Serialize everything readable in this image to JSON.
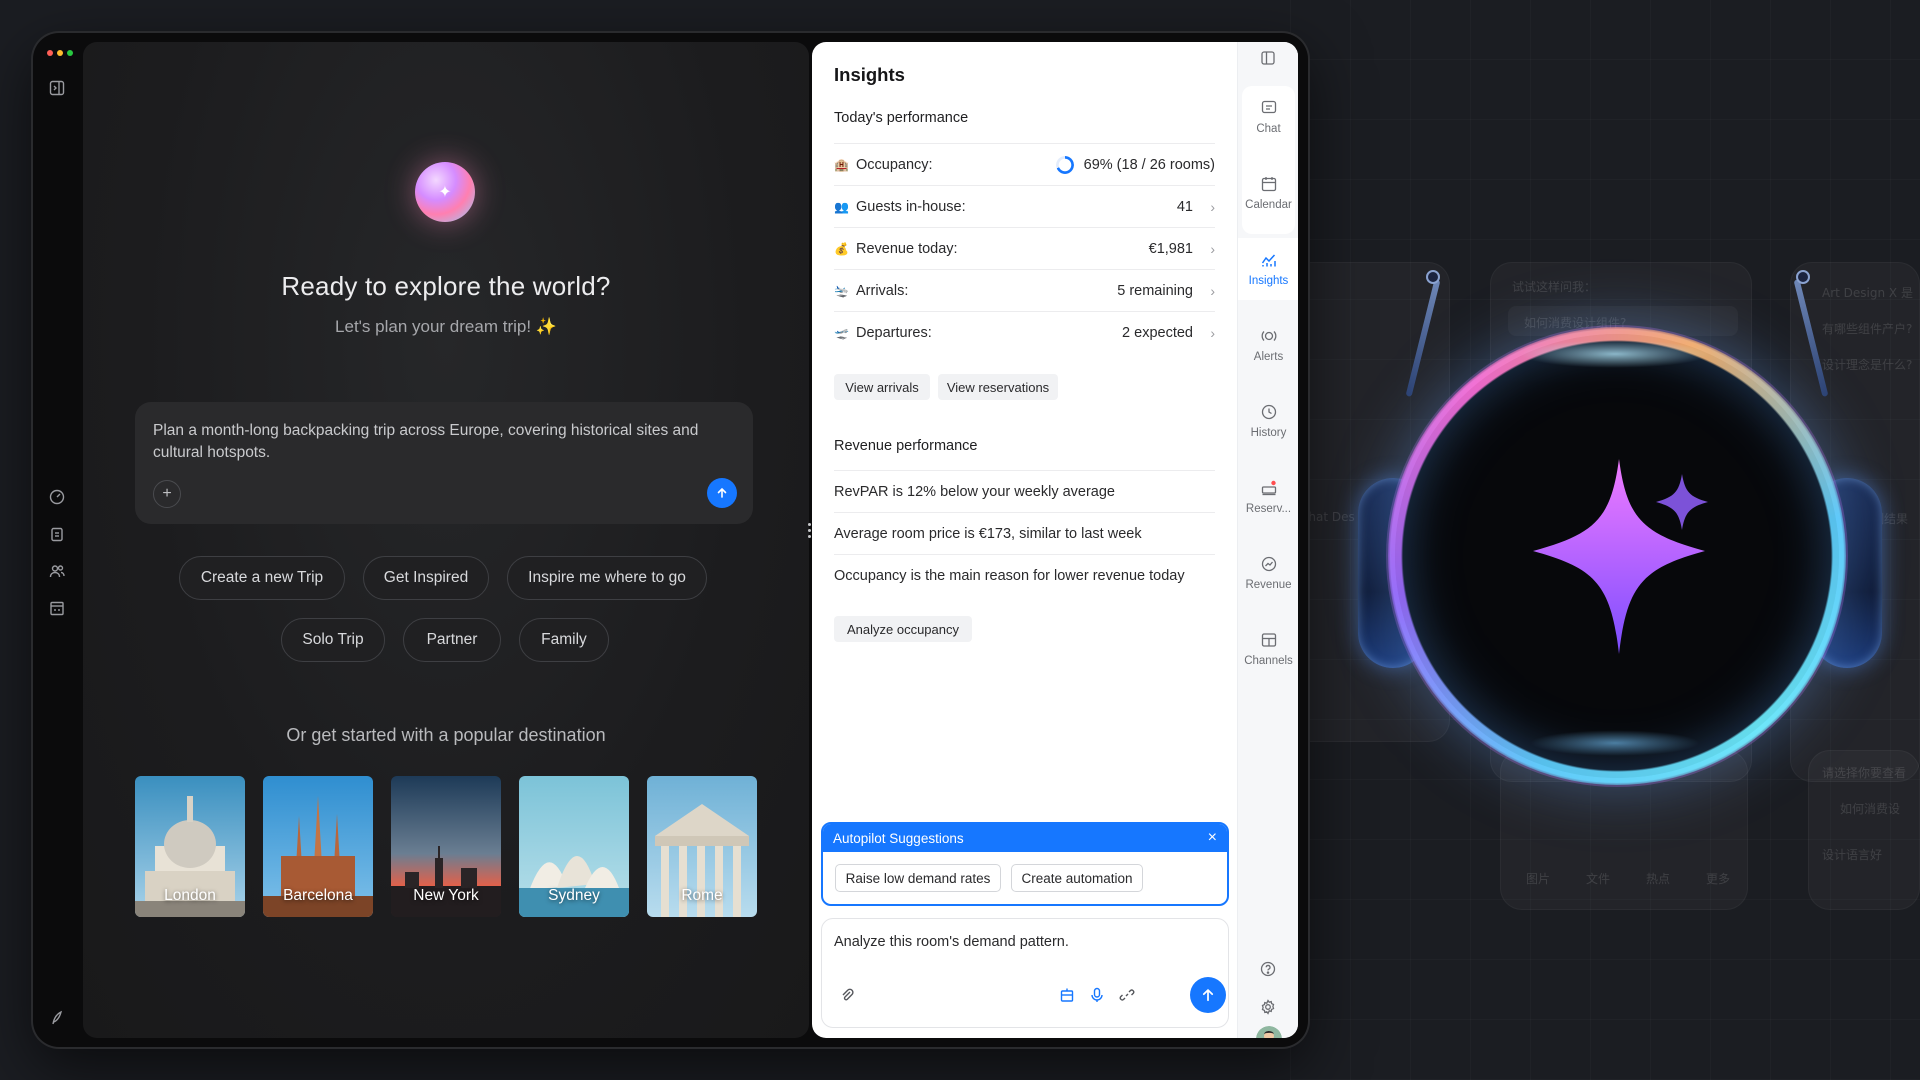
{
  "left_app": {
    "hero": {
      "title": "Ready to explore the world?",
      "subtitle": "Let's plan your dream trip! ✨",
      "orb_glyph": "✦"
    },
    "prompt": {
      "text": "Plan a month-long backpacking trip across Europe, covering historical sites and cultural hotspots.",
      "plus_label": "+"
    },
    "chips": [
      {
        "label": "Create a new Trip"
      },
      {
        "label": "Get Inspired"
      },
      {
        "label": "Inspire me where to go"
      },
      {
        "label": "Solo Trip"
      },
      {
        "label": "Partner"
      },
      {
        "label": "Family"
      }
    ],
    "destinations_title": "Or get started with a popular destination",
    "destinations": [
      {
        "name": "London"
      },
      {
        "name": "Barcelona"
      },
      {
        "name": "New York"
      },
      {
        "name": "Sydney"
      },
      {
        "name": "Rome"
      }
    ],
    "rail_icons": [
      "sidebar-toggle-icon",
      "dashboard-icon",
      "clipboard-icon",
      "users-icon",
      "building-icon",
      "feather-icon"
    ]
  },
  "insights": {
    "title": "Insights",
    "today_heading": "Today's performance",
    "metrics": [
      {
        "emoji": "🏨",
        "label": "Occupancy:",
        "value": "69% (18 / 26 rooms)",
        "fill": 0.69
      },
      {
        "emoji": "👥",
        "label": "Guests in-house:",
        "value": "41"
      },
      {
        "emoji": "💰",
        "label": "Revenue today:",
        "value": "€1,981"
      },
      {
        "emoji": "🛬",
        "label": "Arrivals:",
        "value": "5 remaining"
      },
      {
        "emoji": "🛫",
        "label": "Departures:",
        "value": "2 expected"
      }
    ],
    "actions": {
      "view_arrivals": "View arrivals",
      "view_reservations": "View reservations"
    },
    "revenue_heading": "Revenue performance",
    "revenue_items": [
      "RevPAR is 12% below your weekly average",
      "Average room price is €173, similar to last week",
      "Occupancy is the main reason for lower revenue today"
    ],
    "analyze_button": "Analyze occupancy",
    "autopilot": {
      "title": "Autopilot Suggestions",
      "close": "×",
      "suggestions": [
        "Raise low demand rates",
        "Create automation"
      ]
    },
    "composer": {
      "text": "Analyze this room's demand pattern."
    }
  },
  "side_tabs": [
    {
      "label": "Chat",
      "icon": "chat-icon"
    },
    {
      "label": "Calendar",
      "icon": "calendar-icon"
    },
    {
      "label": "Insights",
      "icon": "insights-icon",
      "active": true
    },
    {
      "label": "Alerts",
      "icon": "alerts-icon"
    },
    {
      "label": "History",
      "icon": "history-icon"
    },
    {
      "label": "Reserv...",
      "icon": "reservations-icon"
    },
    {
      "label": "Revenue",
      "icon": "revenue-icon"
    },
    {
      "label": "Channels",
      "icon": "channels-icon"
    }
  ],
  "background": {
    "ghost_texts": [
      "试试这样问我：",
      "如何消费设计组件?",
      "Art Design X 是",
      "有哪些组件产户?",
      "设计理念是什么?",
      "Chat Des",
      "请选择你要查看",
      "如何消费设",
      "预测结果",
      "设计语言好",
      "图片",
      "文件",
      "热点",
      "更多"
    ]
  },
  "colors": {
    "accent": "#1677ff",
    "page_bg": "#1b1d22",
    "left_app_bg": "#1c1c1e"
  }
}
